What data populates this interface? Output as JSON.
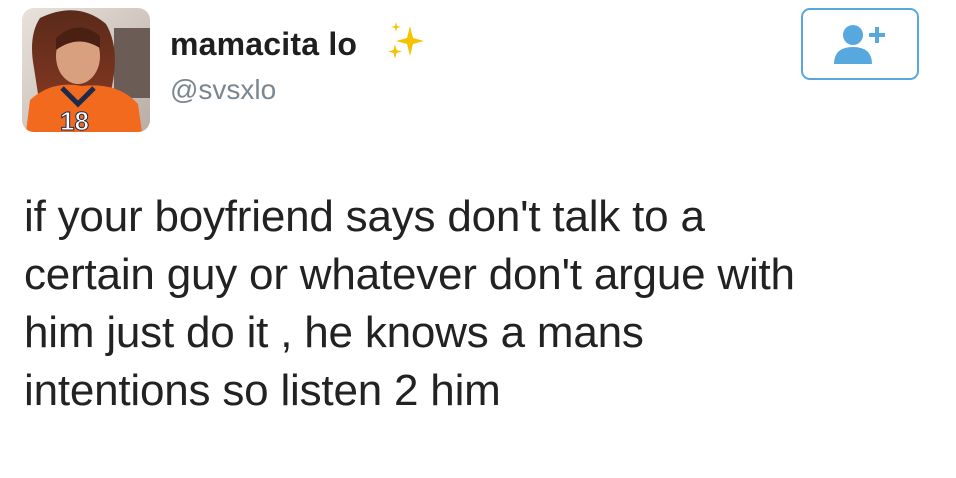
{
  "user": {
    "display_name": "mamacita lo",
    "handle": "@svsxlo",
    "name_emoji": "sparkles-icon",
    "avatar": "profile-photo"
  },
  "actions": {
    "follow_icon": "add-user-icon",
    "follow_color": "#58a8e0"
  },
  "tweet": {
    "lines": [
      "if your boyfriend says don't talk to a",
      "certain guy or whatever don't argue with",
      "him just do it , he knows a mans",
      "intentions so listen 2 him"
    ]
  }
}
